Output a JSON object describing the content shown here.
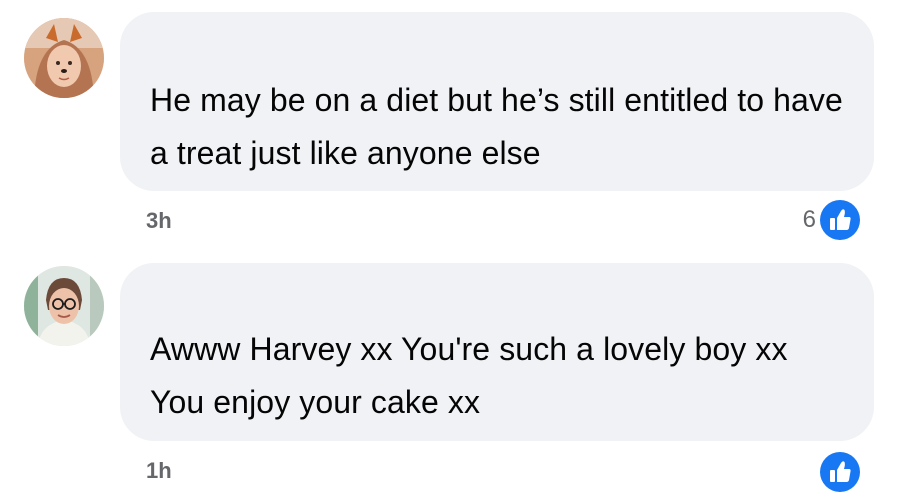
{
  "comments": [
    {
      "text": "He may be on a diet but he’s still entitled to have a treat just like anyone else",
      "time": "3h",
      "reaction_count": "6",
      "reaction_icon": "like-icon"
    },
    {
      "text": "Awww Harvey xx You're such a lovely boy xx You enjoy your cake xx",
      "time": "1h",
      "reaction_count": "",
      "reaction_icon": "like-icon"
    }
  ],
  "colors": {
    "bubble": "#f0f2f5",
    "text": "#050505",
    "meta": "#65676b",
    "like": "#1877f2"
  }
}
